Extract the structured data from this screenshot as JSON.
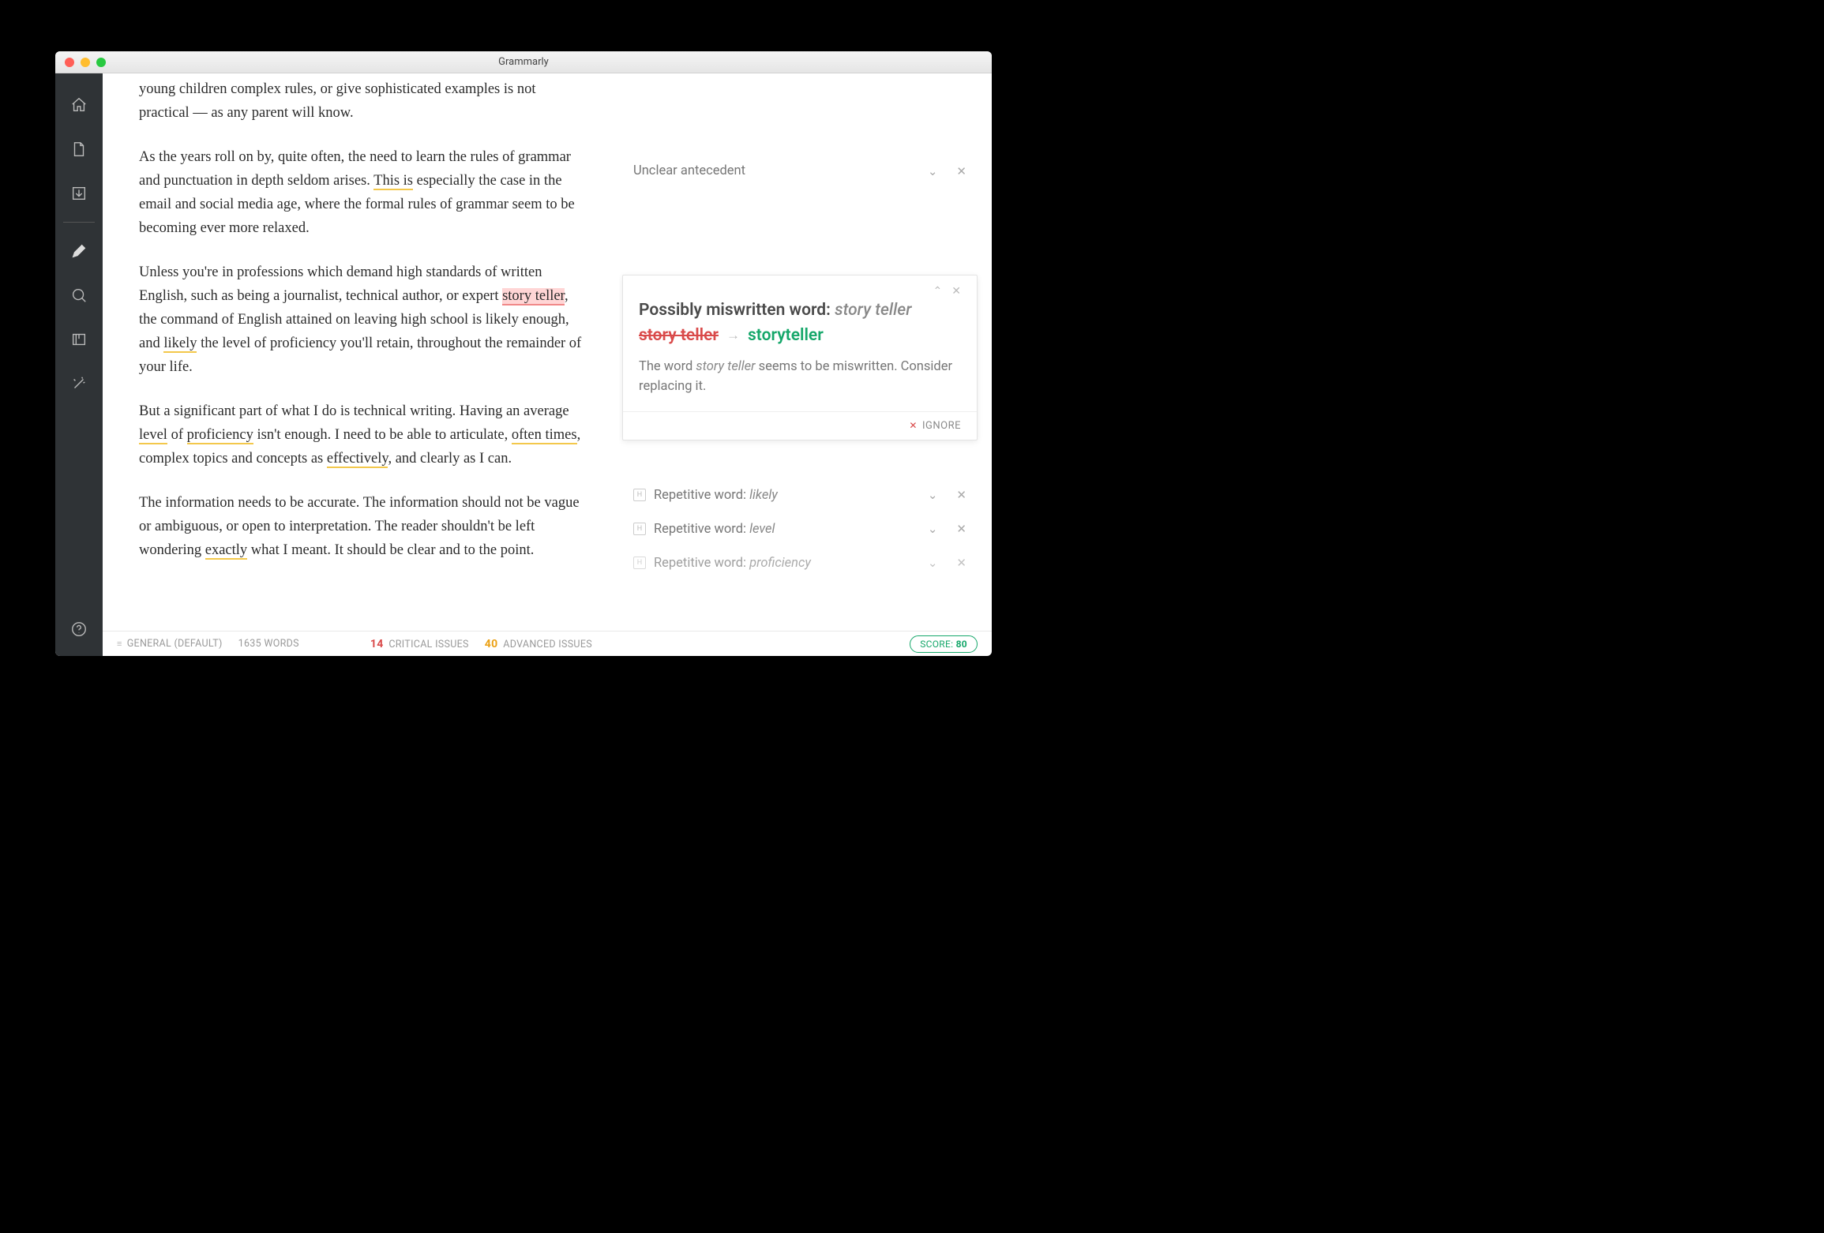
{
  "window": {
    "title": "Grammarly"
  },
  "text": {
    "p1_a": "young children complex rules, or give sophisticated examples is not practical — as any parent will know.",
    "p2_a": "As the years roll on by, quite often, the need to learn the rules of grammar and punctuation in depth seldom arises. ",
    "p2_h1": "This is",
    "p2_b": " especially the case in the email and social media age, where the formal rules of grammar seem to be becoming ever more relaxed.",
    "p3_a": "Unless you're in professions which demand high standards of written English, such as being a journalist, technical author, or expert ",
    "p3_h1": "story teller",
    "p3_b": ", the command of English attained on leaving high school is likely enough, and ",
    "p3_h2": "likely",
    "p3_c": " the level of proficiency you'll retain, throughout the remainder of your life.",
    "p4_a": "But a significant part of what I do is technical writing. Having an average ",
    "p4_h1": "level",
    "p4_b": " of ",
    "p4_h2": "proficiency",
    "p4_c": " isn't enough. I need to be able to articulate, ",
    "p4_h3": "often times",
    "p4_d": ", complex topics and concepts as ",
    "p4_h4": "effectively",
    "p4_e": ", and clearly as I can.",
    "p5_a": "The information needs to be accurate. The information should not be vague or ambiguous, or open to interpretation. The reader shouldn't be left wondering ",
    "p5_h1": "exactly",
    "p5_b": " what I meant. It should be clear and to the point."
  },
  "issues": {
    "top": {
      "label": "Unclear antecedent"
    },
    "card": {
      "title_prefix": "Possibly miswritten word:",
      "title_wrong": "story teller",
      "strike": "story teller",
      "correct": "storyteller",
      "desc_a": "The word ",
      "desc_em": "story teller",
      "desc_b": " seems to be miswritten. Consider replacing it.",
      "ignore": "IGNORE"
    },
    "rep1": {
      "label": "Repetitive word:",
      "word": "likely"
    },
    "rep2": {
      "label": "Repetitive word:",
      "word": "level"
    },
    "rep3": {
      "label": "Repetitive word:",
      "word": "proficiency"
    }
  },
  "status": {
    "mode": "GENERAL (DEFAULT)",
    "words": "1635 WORDS",
    "critical_n": "14",
    "critical_label": "CRITICAL ISSUES",
    "advanced_n": "40",
    "advanced_label": "ADVANCED ISSUES",
    "score_label": "SCORE:",
    "score_n": "80"
  }
}
